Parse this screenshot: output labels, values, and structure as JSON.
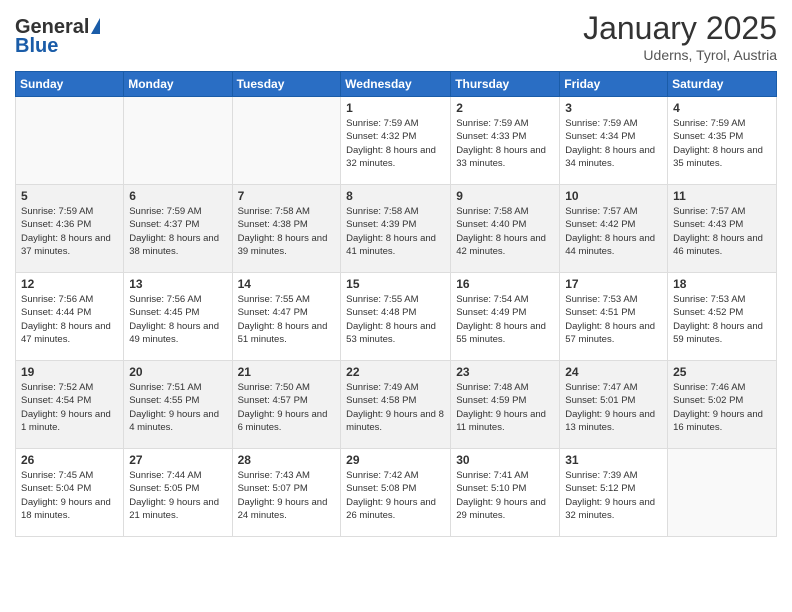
{
  "logo": {
    "general": "General",
    "blue": "Blue"
  },
  "header": {
    "month": "January 2025",
    "location": "Uderns, Tyrol, Austria"
  },
  "days_of_week": [
    "Sunday",
    "Monday",
    "Tuesday",
    "Wednesday",
    "Thursday",
    "Friday",
    "Saturday"
  ],
  "weeks": [
    [
      {
        "day": "",
        "info": ""
      },
      {
        "day": "",
        "info": ""
      },
      {
        "day": "",
        "info": ""
      },
      {
        "day": "1",
        "info": "Sunrise: 7:59 AM\nSunset: 4:32 PM\nDaylight: 8 hours and 32 minutes."
      },
      {
        "day": "2",
        "info": "Sunrise: 7:59 AM\nSunset: 4:33 PM\nDaylight: 8 hours and 33 minutes."
      },
      {
        "day": "3",
        "info": "Sunrise: 7:59 AM\nSunset: 4:34 PM\nDaylight: 8 hours and 34 minutes."
      },
      {
        "day": "4",
        "info": "Sunrise: 7:59 AM\nSunset: 4:35 PM\nDaylight: 8 hours and 35 minutes."
      }
    ],
    [
      {
        "day": "5",
        "info": "Sunrise: 7:59 AM\nSunset: 4:36 PM\nDaylight: 8 hours and 37 minutes."
      },
      {
        "day": "6",
        "info": "Sunrise: 7:59 AM\nSunset: 4:37 PM\nDaylight: 8 hours and 38 minutes."
      },
      {
        "day": "7",
        "info": "Sunrise: 7:58 AM\nSunset: 4:38 PM\nDaylight: 8 hours and 39 minutes."
      },
      {
        "day": "8",
        "info": "Sunrise: 7:58 AM\nSunset: 4:39 PM\nDaylight: 8 hours and 41 minutes."
      },
      {
        "day": "9",
        "info": "Sunrise: 7:58 AM\nSunset: 4:40 PM\nDaylight: 8 hours and 42 minutes."
      },
      {
        "day": "10",
        "info": "Sunrise: 7:57 AM\nSunset: 4:42 PM\nDaylight: 8 hours and 44 minutes."
      },
      {
        "day": "11",
        "info": "Sunrise: 7:57 AM\nSunset: 4:43 PM\nDaylight: 8 hours and 46 minutes."
      }
    ],
    [
      {
        "day": "12",
        "info": "Sunrise: 7:56 AM\nSunset: 4:44 PM\nDaylight: 8 hours and 47 minutes."
      },
      {
        "day": "13",
        "info": "Sunrise: 7:56 AM\nSunset: 4:45 PM\nDaylight: 8 hours and 49 minutes."
      },
      {
        "day": "14",
        "info": "Sunrise: 7:55 AM\nSunset: 4:47 PM\nDaylight: 8 hours and 51 minutes."
      },
      {
        "day": "15",
        "info": "Sunrise: 7:55 AM\nSunset: 4:48 PM\nDaylight: 8 hours and 53 minutes."
      },
      {
        "day": "16",
        "info": "Sunrise: 7:54 AM\nSunset: 4:49 PM\nDaylight: 8 hours and 55 minutes."
      },
      {
        "day": "17",
        "info": "Sunrise: 7:53 AM\nSunset: 4:51 PM\nDaylight: 8 hours and 57 minutes."
      },
      {
        "day": "18",
        "info": "Sunrise: 7:53 AM\nSunset: 4:52 PM\nDaylight: 8 hours and 59 minutes."
      }
    ],
    [
      {
        "day": "19",
        "info": "Sunrise: 7:52 AM\nSunset: 4:54 PM\nDaylight: 9 hours and 1 minute."
      },
      {
        "day": "20",
        "info": "Sunrise: 7:51 AM\nSunset: 4:55 PM\nDaylight: 9 hours and 4 minutes."
      },
      {
        "day": "21",
        "info": "Sunrise: 7:50 AM\nSunset: 4:57 PM\nDaylight: 9 hours and 6 minutes."
      },
      {
        "day": "22",
        "info": "Sunrise: 7:49 AM\nSunset: 4:58 PM\nDaylight: 9 hours and 8 minutes."
      },
      {
        "day": "23",
        "info": "Sunrise: 7:48 AM\nSunset: 4:59 PM\nDaylight: 9 hours and 11 minutes."
      },
      {
        "day": "24",
        "info": "Sunrise: 7:47 AM\nSunset: 5:01 PM\nDaylight: 9 hours and 13 minutes."
      },
      {
        "day": "25",
        "info": "Sunrise: 7:46 AM\nSunset: 5:02 PM\nDaylight: 9 hours and 16 minutes."
      }
    ],
    [
      {
        "day": "26",
        "info": "Sunrise: 7:45 AM\nSunset: 5:04 PM\nDaylight: 9 hours and 18 minutes."
      },
      {
        "day": "27",
        "info": "Sunrise: 7:44 AM\nSunset: 5:05 PM\nDaylight: 9 hours and 21 minutes."
      },
      {
        "day": "28",
        "info": "Sunrise: 7:43 AM\nSunset: 5:07 PM\nDaylight: 9 hours and 24 minutes."
      },
      {
        "day": "29",
        "info": "Sunrise: 7:42 AM\nSunset: 5:08 PM\nDaylight: 9 hours and 26 minutes."
      },
      {
        "day": "30",
        "info": "Sunrise: 7:41 AM\nSunset: 5:10 PM\nDaylight: 9 hours and 29 minutes."
      },
      {
        "day": "31",
        "info": "Sunrise: 7:39 AM\nSunset: 5:12 PM\nDaylight: 9 hours and 32 minutes."
      },
      {
        "day": "",
        "info": ""
      }
    ]
  ]
}
